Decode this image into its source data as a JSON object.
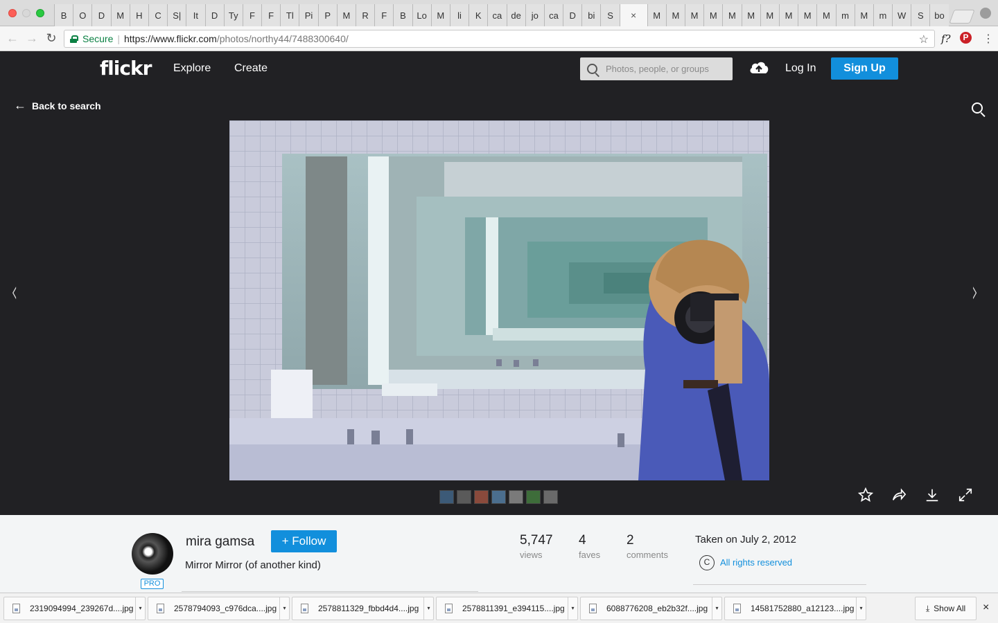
{
  "browser": {
    "tabs": [
      "B",
      "O",
      "D",
      "M",
      "H",
      "C",
      "S|",
      "It",
      "D",
      "Ty",
      "F",
      "F",
      "Tl",
      "Pi",
      "P",
      "M",
      "R",
      "F",
      "B",
      "Lo",
      "M",
      "li",
      "K",
      "ca",
      "de",
      "jo",
      "ca",
      "D",
      "bi",
      "S"
    ],
    "active_tab_close": "×",
    "tabs_after": [
      "M",
      "M",
      "M",
      "M",
      "M",
      "M",
      "M",
      "M",
      "M",
      "M",
      "m",
      "M",
      "m",
      "W",
      "S",
      "bo"
    ],
    "secure_label": "Secure",
    "url_scheme": "https://",
    "url_host": "www.flickr.com",
    "url_path": "/photos/northy44/7488300640/",
    "ext_f": "f?",
    "ext_p": "P"
  },
  "header": {
    "logo": "flickr",
    "nav": [
      "Explore",
      "Create"
    ],
    "search_placeholder": "Photos, people, or groups",
    "login": "Log In",
    "signup": "Sign Up"
  },
  "stage": {
    "back_label": "Back to search",
    "prev_arrow": "‹",
    "next_arrow": "›",
    "thumb_colors": [
      "#3c5a77",
      "#5a5a5a",
      "#8a4a3c",
      "#4b6e8e",
      "#7a7a7a",
      "#3e6d3a",
      "#6a6a6a"
    ]
  },
  "info": {
    "owner": "mira gamsa",
    "pro": "PRO",
    "follow": "+ Follow",
    "title": "Mirror Mirror (of another kind)",
    "stats": [
      {
        "num": "5,747",
        "label": "views"
      },
      {
        "num": "4",
        "label": "faves"
      },
      {
        "num": "2",
        "label": "comments"
      }
    ],
    "taken": "Taken on July 2, 2012",
    "cc_symbol": "C",
    "rights": "All rights reserved"
  },
  "downloads": {
    "items": [
      "2319094994_239267d....jpg",
      "2578794093_c976dca....jpg",
      "2578811329_fbbd4d4....jpg",
      "2578811391_e394115....jpg",
      "6088776208_eb2b32f....jpg",
      "14581752880_a12123....jpg"
    ],
    "show_all": "Show All",
    "close": "×"
  }
}
